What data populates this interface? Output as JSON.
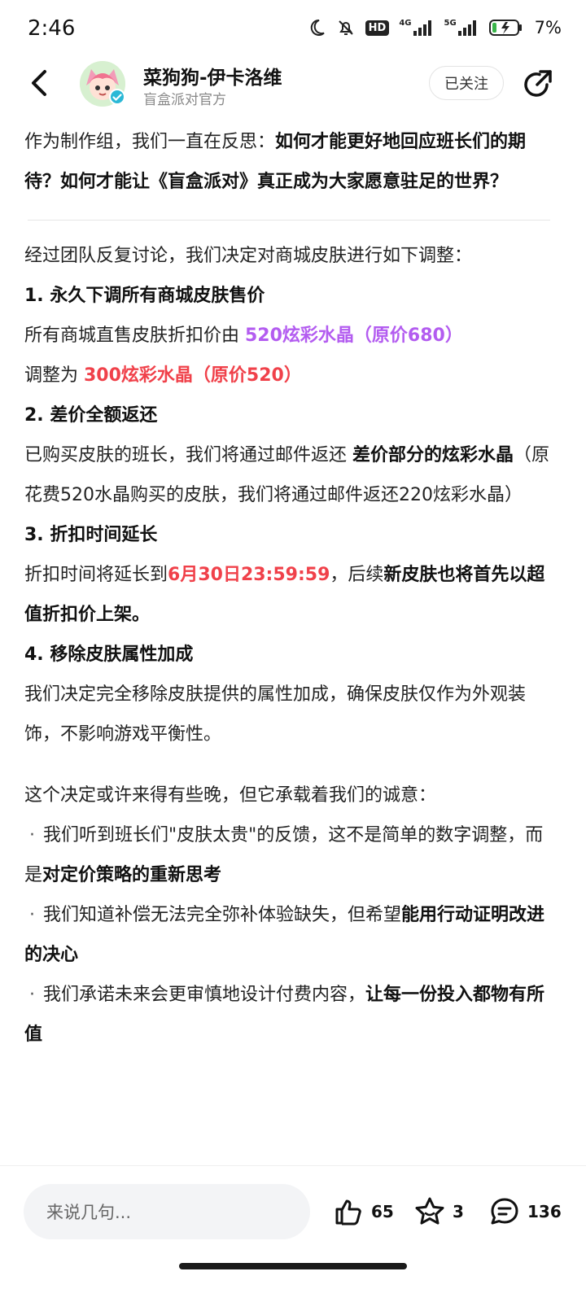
{
  "status_bar": {
    "time": "2:46",
    "hd_label": "HD",
    "net1": "4G",
    "net2": "5G",
    "battery": "7%"
  },
  "header": {
    "author_name": "菜狗狗-伊卡洛维",
    "author_sub": "盲盒派对官方",
    "follow_label": "已关注"
  },
  "article": {
    "intro_normal": "作为制作组，我们一直在反思：",
    "intro_bold": "如何才能更好地回应班长们的期待？如何才能让《盲盒派对》真正成为大家愿意驻足的世界？",
    "lead": "经过团队反复讨论，我们决定对商城皮肤进行如下调整：",
    "h1": "1. 永久下调所有商城皮肤售价",
    "p1_a": "所有商城直售皮肤折扣价由 ",
    "p1_purple": "520炫彩水晶（原价680）",
    "p1_b": "调整为 ",
    "p1_red": "300炫彩水晶（原价520）",
    "h2": "2. 差价全额返还",
    "p2_a": "已购买皮肤的班长，我们将通过邮件返还 ",
    "p2_bold": "差价部分的炫彩水晶",
    "p2_b": "（原花费520水晶购买的皮肤，我们将通过邮件返还220炫彩水晶）",
    "h3": "3. 折扣时间延长",
    "p3_a": "折扣时间将延长到",
    "p3_red": "6月30日23:59:59",
    "p3_b": "，后续",
    "p3_bold": "新皮肤也将首先以超值折扣价上架。",
    "h4": "4. 移除皮肤属性加成",
    "p4": "我们决定完全移除皮肤提供的属性加成，确保皮肤仅作为外观装饰，不影响游戏平衡性。",
    "closing": "这个决定或许来得有些晚，但它承载着我们的诚意：",
    "bullet_char": "·",
    "b1_normal": "我们听到班长们\"皮肤太贵\"的反馈，这不是简单的数字调整，而是",
    "b1_bold": "对定价策略的重新思考",
    "b2_normal": "我们知道补偿无法完全弥补体验缺失，但希望",
    "b2_bold": "能用行动证明改进的决心",
    "b3_normal": "我们承诺未来会更审慎地设计付费内容，",
    "b3_bold": "让每一份投入都物有所值"
  },
  "bottom_bar": {
    "comment_placeholder": "来说几句...",
    "likes": "65",
    "favorites": "3",
    "comments": "136"
  },
  "colors": {
    "purple_highlight": "#b35cf0",
    "red_highlight": "#f0414a",
    "verified_badge": "#2bb8d6"
  },
  "icons": [
    "back-arrow-icon",
    "share-icon",
    "like-icon",
    "star-icon",
    "comment-icon",
    "moon-icon",
    "mute-bell-icon",
    "signal-icon",
    "battery-icon"
  ]
}
